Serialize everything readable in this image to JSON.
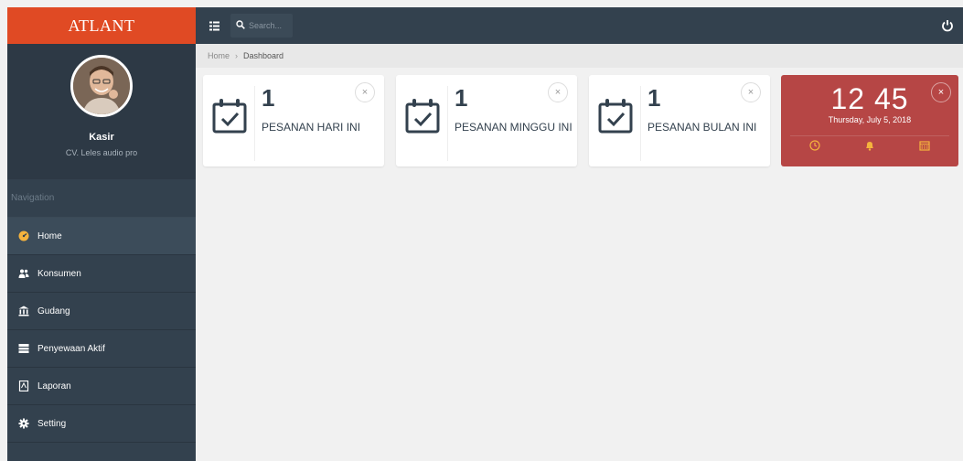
{
  "sidebar": {
    "logo": "ATLANT",
    "profile": {
      "name": "Kasir",
      "company": "CV. Leles audio pro"
    },
    "nav_heading": "Navigation",
    "items": [
      {
        "label": "Home",
        "icon": "dashboard-icon",
        "active": true
      },
      {
        "label": "Konsumen",
        "icon": "users-icon"
      },
      {
        "label": "Gudang",
        "icon": "bank-icon"
      },
      {
        "label": "Penyewaan Aktif",
        "icon": "list-icon"
      },
      {
        "label": "Laporan",
        "icon": "file-icon"
      },
      {
        "label": "Setting",
        "icon": "gear-icon"
      }
    ]
  },
  "topbar": {
    "search_placeholder": "Search..."
  },
  "breadcrumb": {
    "home": "Home",
    "current": "Dashboard"
  },
  "widgets": [
    {
      "count": "1",
      "title": "PESANAN HARI INI"
    },
    {
      "count": "1",
      "title": "PESANAN MINGGU INI"
    },
    {
      "count": "1",
      "title": "PESANAN BULAN INI"
    }
  ],
  "clock": {
    "time": "12 45",
    "date": "Thursday, July 5, 2018"
  },
  "colors": {
    "accent": "#e04a24",
    "sidebar": "#33414e",
    "clock_bg": "#b64645"
  }
}
